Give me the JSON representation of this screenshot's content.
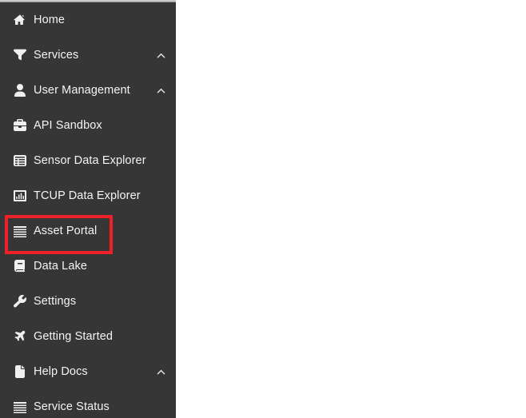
{
  "colors": {
    "sidebar_bg": "#363636",
    "text": "#f4f4f4",
    "highlight_outline": "#ee2028",
    "content_bg": "#ffffff",
    "top_strip": "#c9c9c9"
  },
  "sidebar": {
    "items": [
      {
        "label": "Home",
        "icon": "home-icon",
        "chevron": null,
        "highlighted": false
      },
      {
        "label": "Services",
        "icon": "filter-icon",
        "chevron": "chevron-up-icon",
        "highlighted": false
      },
      {
        "label": "User Management",
        "icon": "user-icon",
        "chevron": "chevron-up-icon",
        "highlighted": false
      },
      {
        "label": "API Sandbox",
        "icon": "briefcase-icon",
        "chevron": null,
        "highlighted": false
      },
      {
        "label": "Sensor Data Explorer",
        "icon": "table-list-icon",
        "chevron": null,
        "highlighted": false
      },
      {
        "label": "TCUP Data Explorer",
        "icon": "bar-chart-icon",
        "chevron": null,
        "highlighted": false
      },
      {
        "label": "Asset Portal",
        "icon": "list-lines-icon",
        "chevron": null,
        "highlighted": true
      },
      {
        "label": "Data Lake",
        "icon": "book-icon",
        "chevron": null,
        "highlighted": false
      },
      {
        "label": "Settings",
        "icon": "wrench-icon",
        "chevron": null,
        "highlighted": false
      },
      {
        "label": "Getting Started",
        "icon": "plane-icon",
        "chevron": null,
        "highlighted": false
      },
      {
        "label": "Help Docs",
        "icon": "file-icon",
        "chevron": "chevron-up-icon",
        "highlighted": false
      },
      {
        "label": "Service Status",
        "icon": "list-lines-icon",
        "chevron": null,
        "highlighted": false
      }
    ]
  },
  "content": {
    "body_text": ""
  }
}
